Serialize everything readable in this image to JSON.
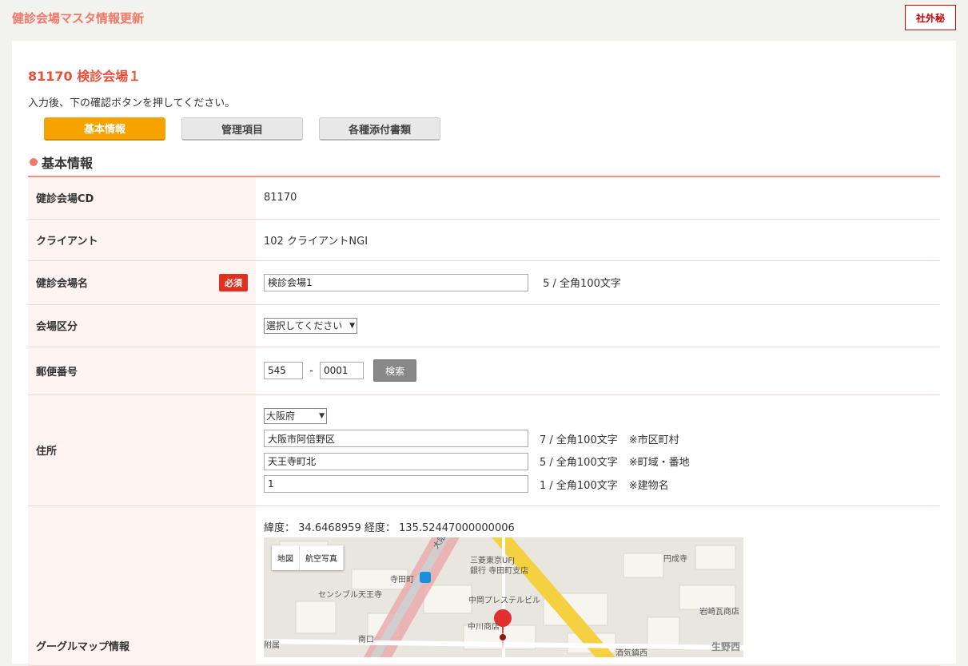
{
  "header": {
    "title": "健診会場マスタ情報更新",
    "confidential": "社外秘"
  },
  "venue": {
    "heading": "81170 検診会場１",
    "instruction": "入力後、下の確認ボタンを押してください。"
  },
  "tabs": [
    {
      "label": "基本情報",
      "active": true
    },
    {
      "label": "管理項目",
      "active": false
    },
    {
      "label": "各種添付書類",
      "active": false
    }
  ],
  "section": {
    "title": "基本情報"
  },
  "form": {
    "venue_cd": {
      "label": "健診会場CD",
      "value": "81170"
    },
    "client": {
      "label": "クライアント",
      "value": "102 クライアントNGI"
    },
    "venue_name": {
      "label": "健診会場名",
      "required": "必須",
      "value": "検診会場1",
      "counter": "5 / 全角100文字"
    },
    "venue_type": {
      "label": "会場区分",
      "selected": "選択してください"
    },
    "postal": {
      "label": "郵便番号",
      "part1": "545",
      "sep": "-",
      "part2": "0001",
      "search": "検索"
    },
    "address": {
      "label": "住所",
      "prefecture": "大阪府",
      "city": {
        "value": "大阪市阿倍野区",
        "counter": "7 / 全角100文字",
        "note": "※市区町村"
      },
      "town": {
        "value": "天王寺町北",
        "counter": "5 / 全角100文字",
        "note": "※町域・番地"
      },
      "building": {
        "value": "1",
        "counter": "1 / 全角100文字",
        "note": "※建物名"
      }
    },
    "map": {
      "label": "グーグルマップ情報",
      "lat_label": "緯度：",
      "lat": "34.6468959",
      "lng_label": "経度：",
      "lng": "135.52447000000006",
      "btn_map": "地図",
      "btn_satellite": "航空写真",
      "labels": [
        "三菱東京UFJ",
        "銀行 寺田町支店",
        "寺田町",
        "大阪環状",
        "センシブル天王寺",
        "中岡プレステルビル",
        "中川商店",
        "円成寺",
        "岩崎瓦商店",
        "南口",
        "生野西",
        "附属",
        "酒気鎮西"
      ]
    }
  },
  "colors": {
    "accent": "#f07868",
    "tab_active": "#f6a300",
    "required": "#e03020"
  }
}
